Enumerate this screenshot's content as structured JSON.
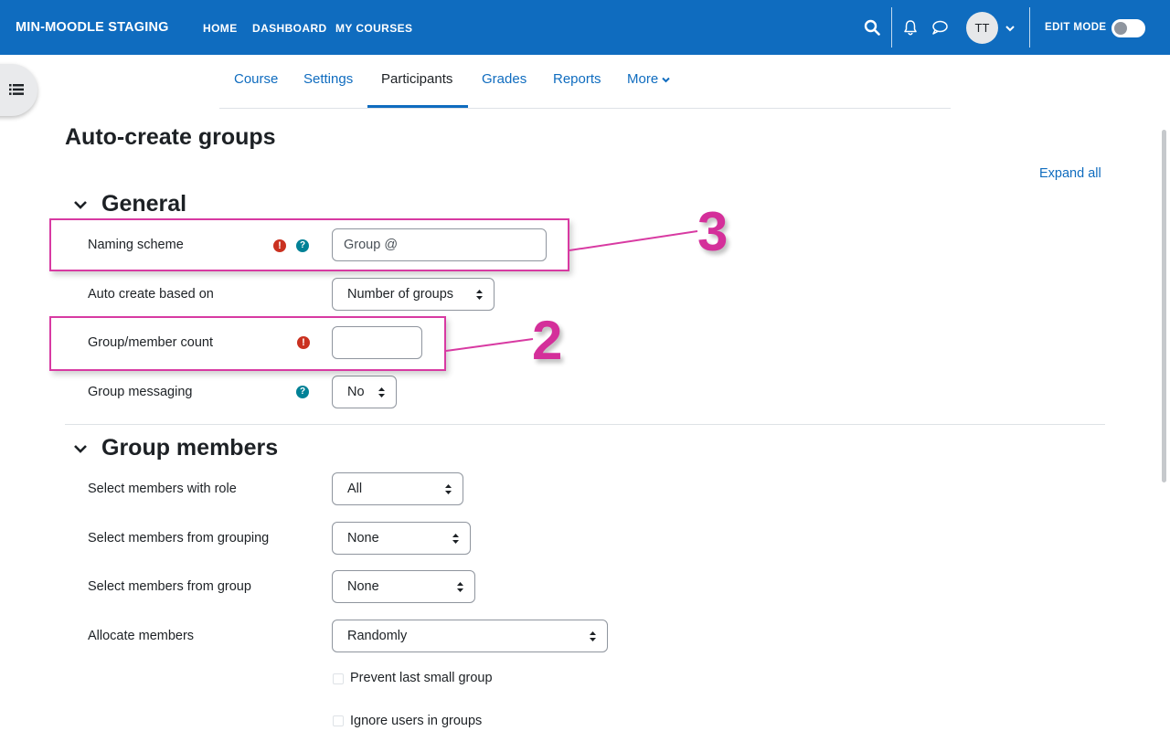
{
  "navbar": {
    "brand": "MIN-MOODLE STAGING",
    "links": [
      "HOME",
      "DASHBOARD",
      "MY COURSES"
    ],
    "avatar_initials": "TT",
    "edit_mode_label": "EDIT MODE",
    "edit_mode_on": false,
    "icons": [
      "search-icon",
      "bell-icon",
      "message-icon",
      "chevron-down-icon"
    ]
  },
  "secondary_nav": {
    "tabs": [
      "Course",
      "Settings",
      "Participants",
      "Grades",
      "Reports",
      "More"
    ],
    "active_tab": "Participants"
  },
  "page_title": "Auto-create groups",
  "expand_all": "Expand all",
  "general": {
    "heading": "General",
    "naming_scheme": {
      "label": "Naming scheme",
      "value": "Group @"
    },
    "auto_create_based_on": {
      "label": "Auto create based on",
      "value": "Number of groups"
    },
    "group_member_count": {
      "label": "Group/member count",
      "value": ""
    },
    "group_messaging": {
      "label": "Group messaging",
      "value": "No"
    }
  },
  "group_members": {
    "heading": "Group members",
    "role": {
      "label": "Select members with role",
      "value": "All"
    },
    "grouping": {
      "label": "Select members from grouping",
      "value": "None"
    },
    "group": {
      "label": "Select members from group",
      "value": "None"
    },
    "allocate": {
      "label": "Allocate members",
      "value": "Randomly"
    },
    "prevent_small": {
      "label": "Prevent last small group",
      "checked": false
    },
    "ignore_users": {
      "label": "Ignore users in groups",
      "checked": false
    }
  },
  "annotations": {
    "callout_3": "3",
    "callout_2": "2",
    "color": "#d42f9a"
  },
  "icon_glyphs": {
    "required": "!",
    "help": "?"
  },
  "colors": {
    "primary": "#0f6cbf",
    "required": "#ca3120",
    "help": "#008196"
  }
}
